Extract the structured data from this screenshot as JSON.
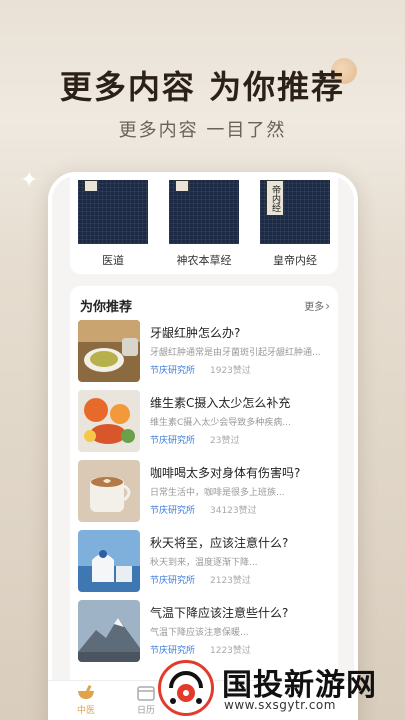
{
  "hero": {
    "title": "更多内容 为你推荐",
    "subtitle": "更多内容 一目了然"
  },
  "books": [
    {
      "label": "医道"
    },
    {
      "label": "神农本草经"
    },
    {
      "label": "皇帝内经",
      "cover_text": "帝内经"
    }
  ],
  "recommend": {
    "header": "为你推荐",
    "more": "更多",
    "items": [
      {
        "title": "牙龈红肿怎么办?",
        "desc": "牙龈红肿通常是由牙菌斑引起牙龈红肿通...",
        "author": "节庆研究所",
        "likes": "1923赞过"
      },
      {
        "title": "维生素C摄入太少怎么补充",
        "desc": "维生素C摄入太少会导致多种疾病...",
        "author": "节庆研究所",
        "likes": "23赞过"
      },
      {
        "title": "咖啡喝太多对身体有伤害吗?",
        "desc": "日常生活中，咖啡是很多上班族...",
        "author": "节庆研究所",
        "likes": "34123赞过"
      },
      {
        "title": "秋天将至，应该注意什么?",
        "desc": "秋天到来，温度逐渐下降...",
        "author": "节庆研究所",
        "likes": "2123赞过"
      },
      {
        "title": "气温下降应该注意些什么?",
        "desc": "气温下降应该注意保暖...",
        "author": "节庆研究所",
        "likes": "1223赞过"
      }
    ]
  },
  "tabs": [
    {
      "label": "中医",
      "active": true
    },
    {
      "label": "日历",
      "active": false
    }
  ],
  "watermark": {
    "text": "国投新游网",
    "url": "www.sxsgytr.com"
  },
  "colors": {
    "accent": "#e0a24a",
    "link": "#3b7ad9",
    "book": "#1c2a45"
  }
}
